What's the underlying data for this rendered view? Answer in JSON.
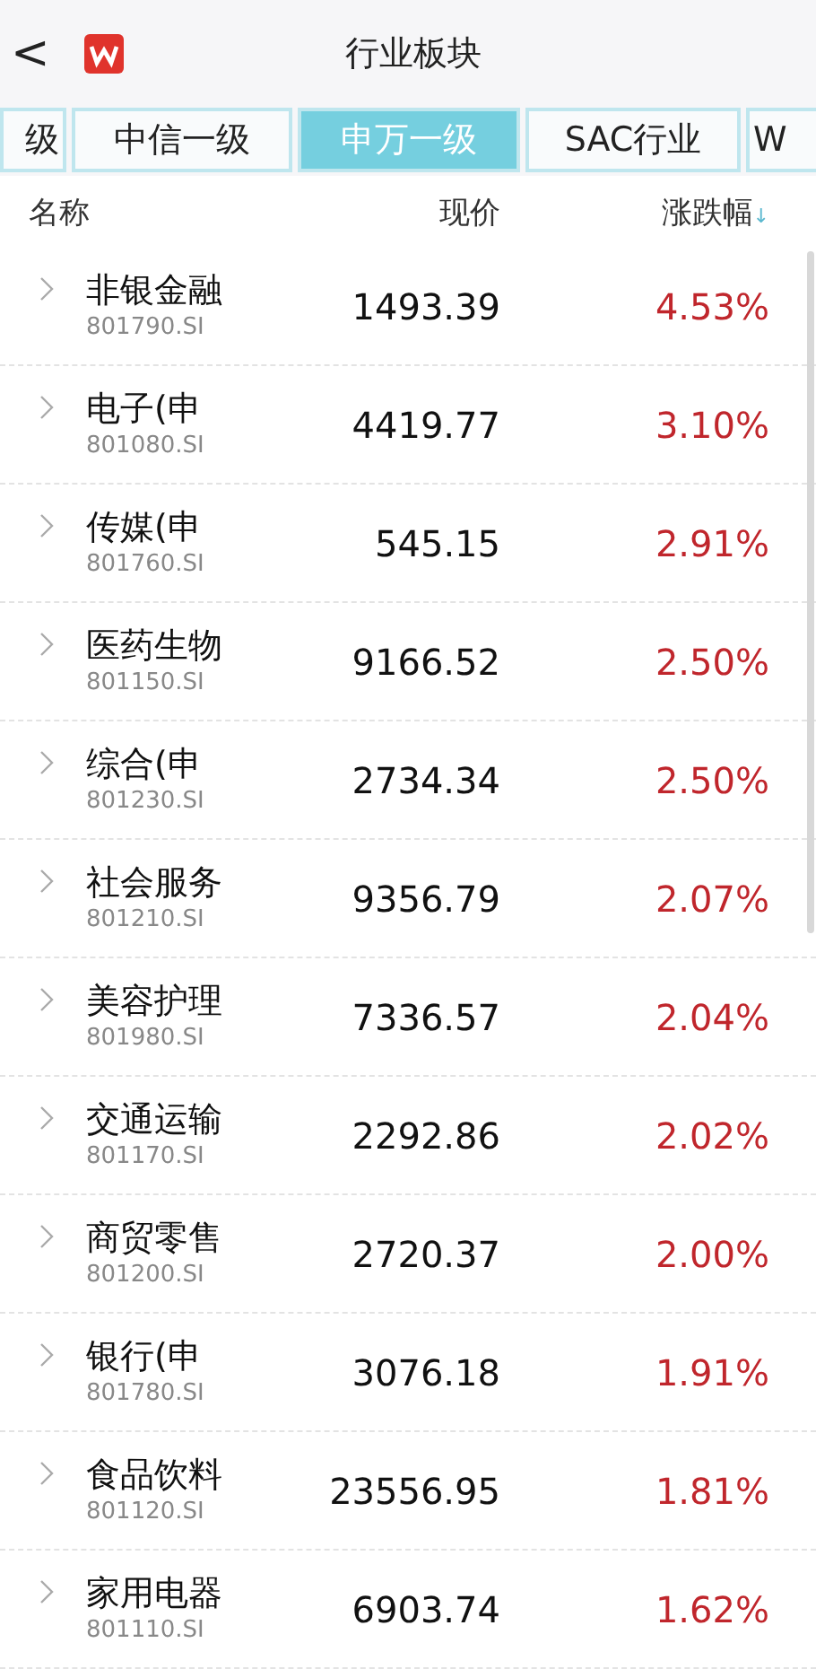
{
  "header": {
    "back": "<",
    "title": "行业板块"
  },
  "tabs": [
    {
      "label": "级",
      "selected": false
    },
    {
      "label": "中信一级",
      "selected": false
    },
    {
      "label": "申万一级",
      "selected": true
    },
    {
      "label": "SAC行业",
      "selected": false
    },
    {
      "label": "W",
      "selected": false
    }
  ],
  "table": {
    "columns": [
      {
        "label": "名称"
      },
      {
        "label": "现价"
      },
      {
        "label": "涨跌幅",
        "sort": "↓"
      }
    ],
    "rows": [
      {
        "name": "非银金融",
        "code": "801790.SI",
        "price": "1493.39",
        "change": "4.53%"
      },
      {
        "name": "电子(申",
        "code": "801080.SI",
        "price": "4419.77",
        "change": "3.10%"
      },
      {
        "name": "传媒(申",
        "code": "801760.SI",
        "price": "545.15",
        "change": "2.91%"
      },
      {
        "name": "医药生物",
        "code": "801150.SI",
        "price": "9166.52",
        "change": "2.50%"
      },
      {
        "name": "综合(申",
        "code": "801230.SI",
        "price": "2734.34",
        "change": "2.50%"
      },
      {
        "name": "社会服务",
        "code": "801210.SI",
        "price": "9356.79",
        "change": "2.07%"
      },
      {
        "name": "美容护理",
        "code": "801980.SI",
        "price": "7336.57",
        "change": "2.04%"
      },
      {
        "name": "交通运输",
        "code": "801170.SI",
        "price": "2292.86",
        "change": "2.02%"
      },
      {
        "name": "商贸零售",
        "code": "801200.SI",
        "price": "2720.37",
        "change": "2.00%"
      },
      {
        "name": "银行(申",
        "code": "801780.SI",
        "price": "3076.18",
        "change": "1.91%"
      },
      {
        "name": "食品饮料",
        "code": "801120.SI",
        "price": "23556.95",
        "change": "1.81%"
      },
      {
        "name": "家用电器",
        "code": "801110.SI",
        "price": "6903.74",
        "change": "1.62%"
      }
    ]
  }
}
